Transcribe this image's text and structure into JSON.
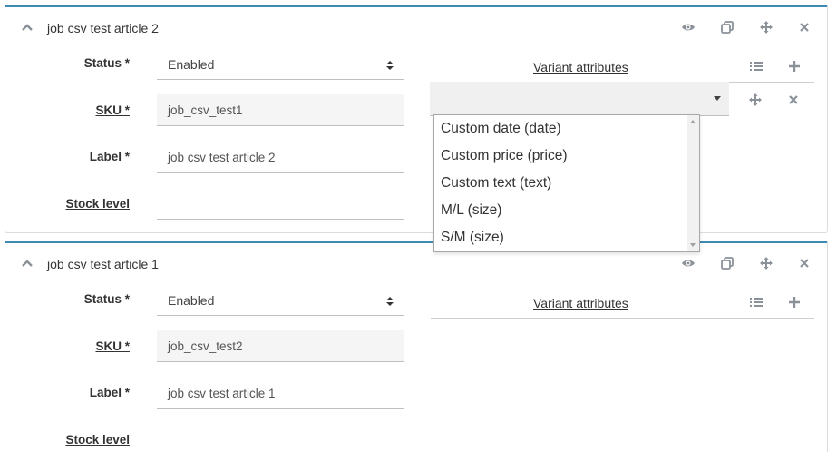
{
  "articles": [
    {
      "title": "job csv test article 2",
      "fields": {
        "status_label": "Status *",
        "status_value": "Enabled",
        "sku_label": "SKU *",
        "sku_value": "job_csv_test1",
        "label_label": "Label *",
        "label_value": "job csv test article 2",
        "stock_label": "Stock level",
        "stock_value": ""
      },
      "variant_attributes_title": "Variant attributes"
    },
    {
      "title": "job csv test article 1",
      "fields": {
        "status_label": "Status *",
        "status_value": "Enabled",
        "sku_label": "SKU *",
        "sku_value": "job_csv_test2",
        "label_label": "Label *",
        "label_value": "job csv test article 1",
        "stock_label": "Stock level",
        "stock_value": ""
      },
      "variant_attributes_title": "Variant attributes"
    }
  ],
  "attribute_dropdown": {
    "options": [
      "Custom date (date)",
      "Custom price (price)",
      "Custom text (text)",
      "M/L (size)",
      "S/M (size)"
    ]
  },
  "icons": {
    "collapse": "chevron-up-icon",
    "view": "eye-icon",
    "duplicate": "copy-icon",
    "move": "move-icon",
    "delete": "close-icon",
    "list": "list-icon",
    "add": "plus-icon",
    "select_arrows": "sort-arrows-icon",
    "dropdown_caret": "caret-down-icon"
  },
  "colors": {
    "card_accent": "#3f8bb0",
    "icon": "#8a9199",
    "readonly_bg": "#f5f5f5"
  }
}
